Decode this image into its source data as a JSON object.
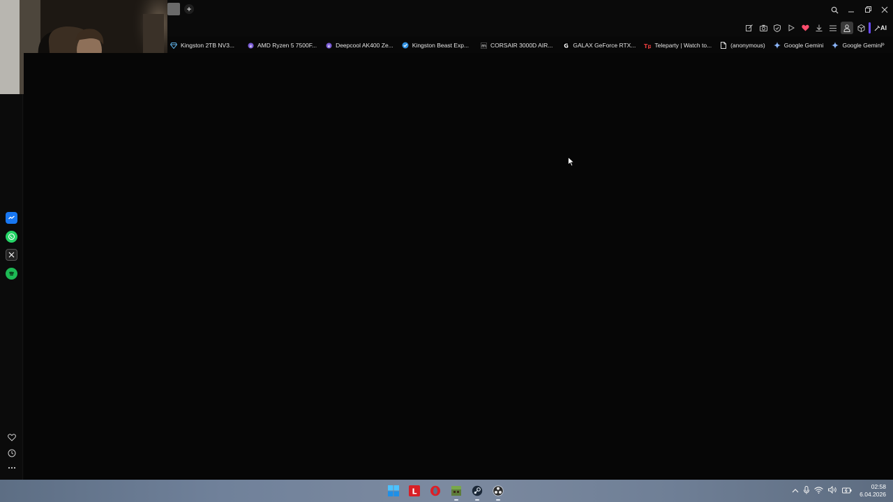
{
  "bookmarks": [
    {
      "label": "Kingston 2TB NV3...",
      "icon": "diamond-icon",
      "color": "#5fb0e6"
    },
    {
      "label": "AMD Ryzen 5 7500F...",
      "icon": "shopping-logo-icon",
      "color": "#7b5cd6"
    },
    {
      "label": "Deepcool AK400 Ze...",
      "icon": "shopping-logo-icon",
      "color": "#7b5cd6"
    },
    {
      "label": "Kingston Beast Exp...",
      "icon": "check-badge-icon",
      "color": "#2f8fe0"
    },
    {
      "label": "CORSAIR 3000D AIR...",
      "icon": "m-logo-icon",
      "color": "#ffffff"
    },
    {
      "label": "GALAX GeForce RTX...",
      "icon": "g-logo-icon",
      "color": "#ffffff"
    },
    {
      "label": "Teleparty | Watch to...",
      "icon": "tp-logo-icon",
      "color": "#e23b3b"
    },
    {
      "label": "(anonymous)",
      "icon": "document-icon",
      "color": "#dddddd"
    },
    {
      "label": "Google Gemini",
      "icon": "gemini-star-icon",
      "color": "#8ab4f8"
    },
    {
      "label": "Google Gemini",
      "icon": "gemini-star-icon",
      "color": "#8ab4f8"
    }
  ],
  "toolbar": {
    "ai_label": "AI",
    "icons": [
      "edit-icon",
      "camera-icon",
      "shield-icon",
      "play-icon",
      "heart-icon",
      "download-icon",
      "menu-icon",
      "profile-icon",
      "cube-icon",
      "ai-icon"
    ]
  },
  "sidebar_apps": [
    {
      "name": "messenger",
      "color": "#1877f2"
    },
    {
      "name": "whatsapp",
      "color": "#25d366"
    },
    {
      "name": "x",
      "color": "#222222"
    },
    {
      "name": "spotify",
      "color": "#1db954"
    }
  ],
  "taskbar": {
    "time": "02:58",
    "date": "6.04.2026",
    "apps": [
      "windows-start",
      "l-app",
      "opera-browser",
      "minecraft-launcher",
      "steam",
      "obs-studio"
    ]
  },
  "colors": {
    "accent": "#6a4cff",
    "heart": "#ff4d6d",
    "opera_red": "#e01e26"
  }
}
